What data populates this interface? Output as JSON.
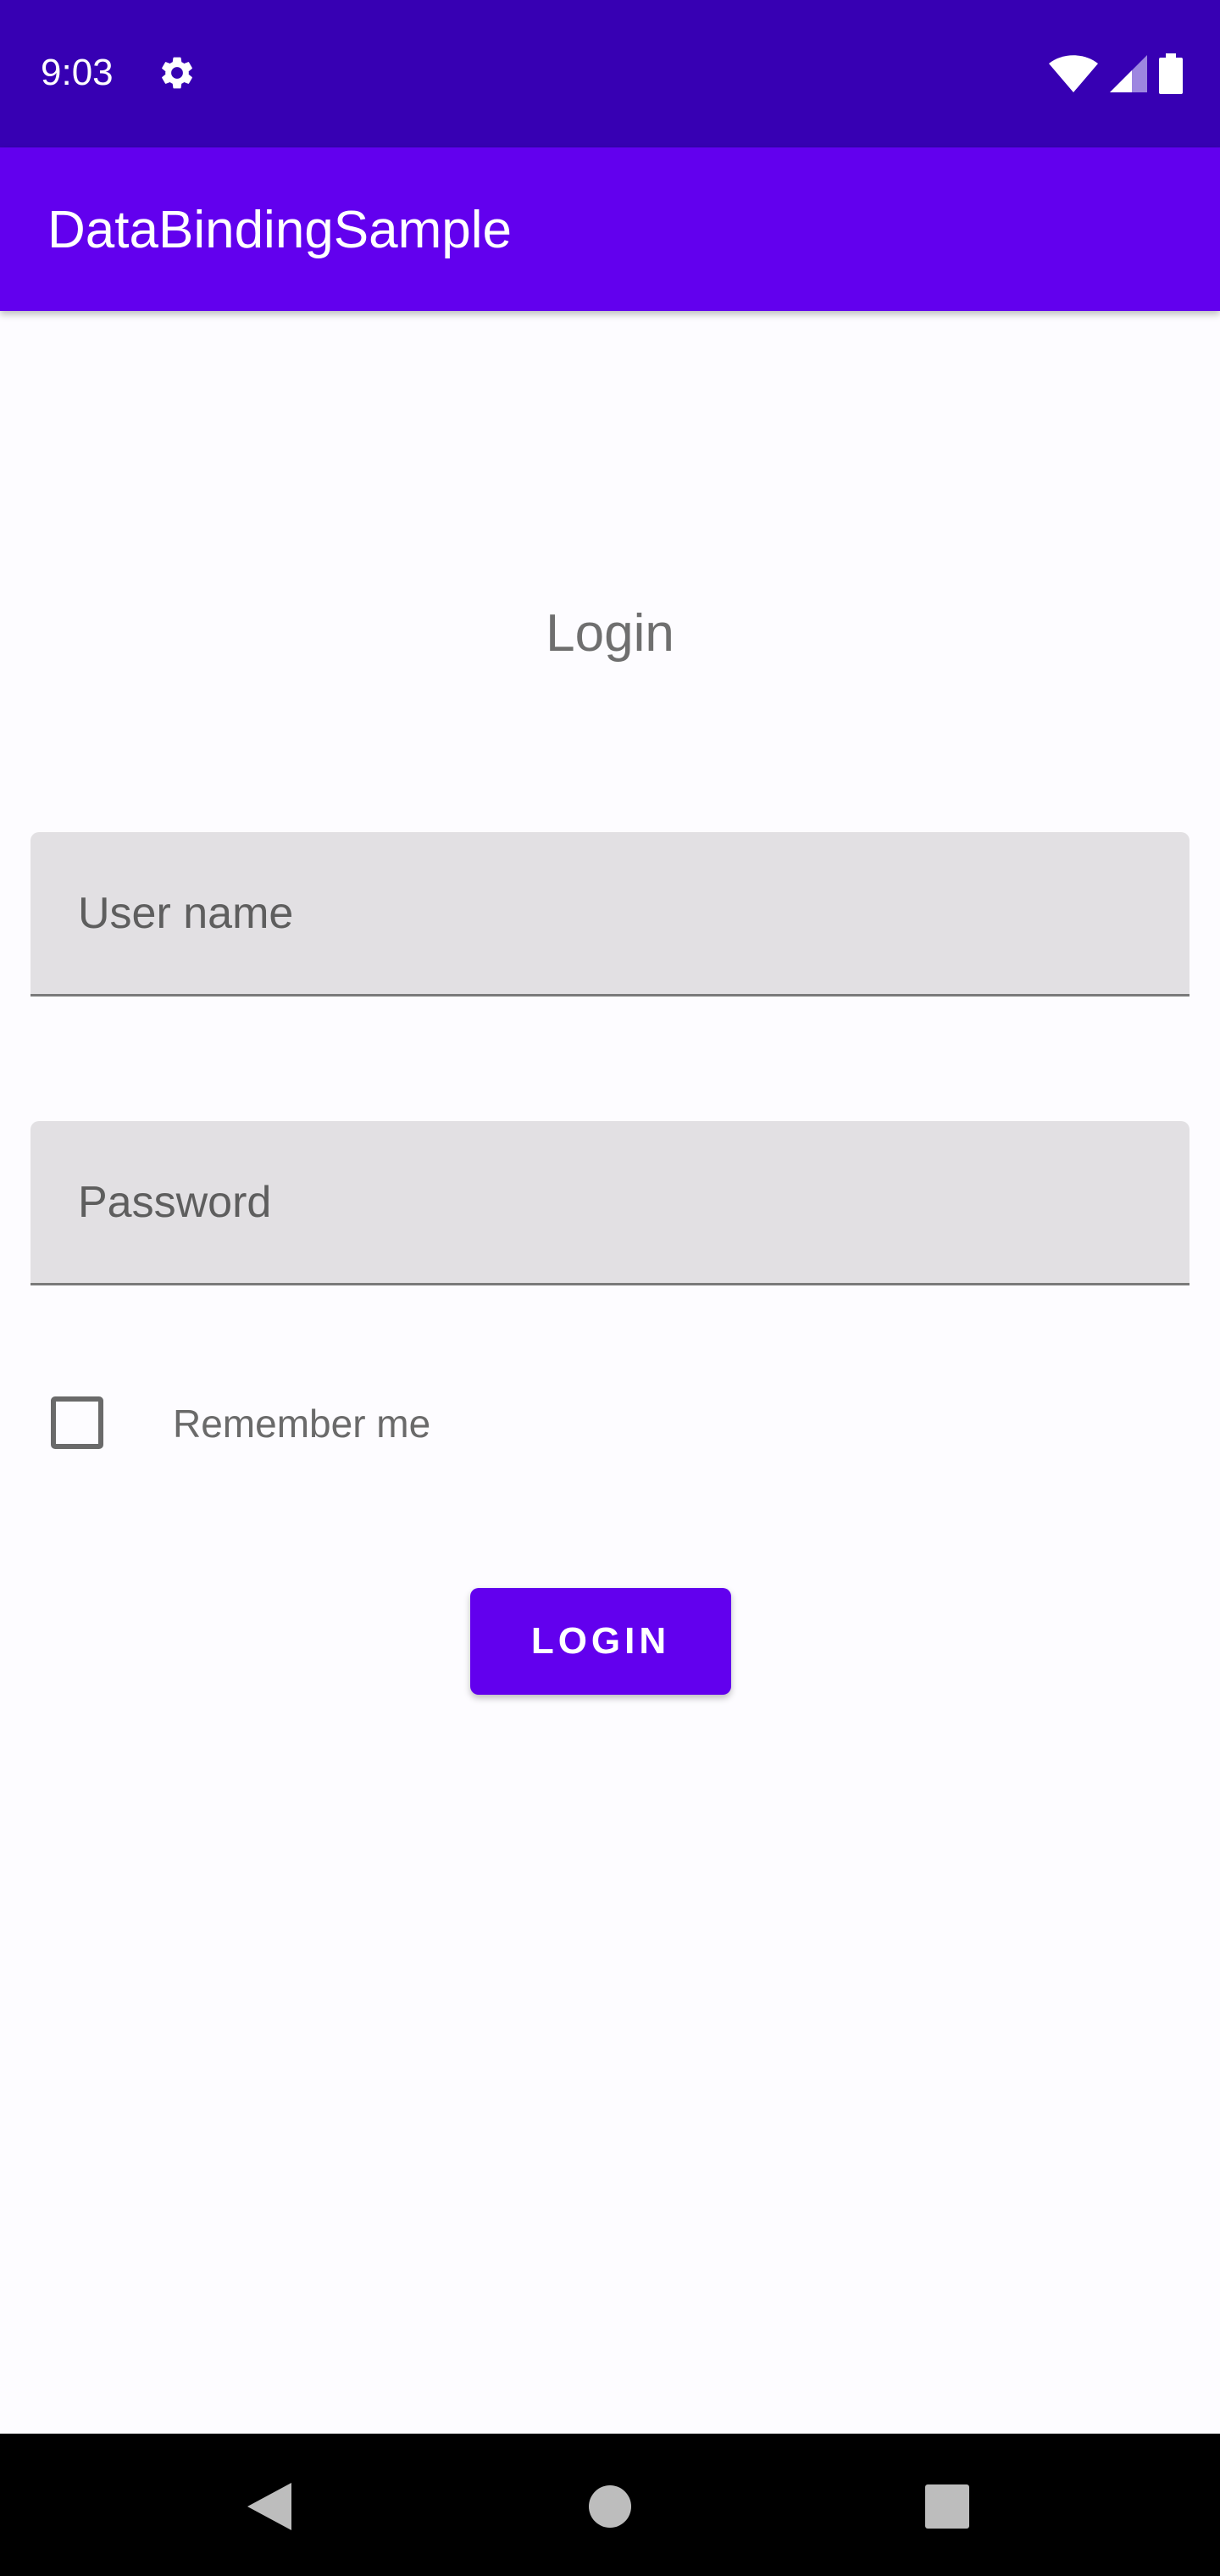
{
  "status_bar": {
    "time": "9:03",
    "icons": [
      "settings-gear-icon",
      "wifi-icon",
      "cellular-signal-icon",
      "battery-icon"
    ]
  },
  "app_bar": {
    "title": "DataBindingSample"
  },
  "login_form": {
    "title": "Login",
    "username_placeholder": "User name",
    "username_value": "",
    "password_placeholder": "Password",
    "password_value": "",
    "remember_me_label": "Remember me",
    "remember_me_checked": false,
    "login_button_label": "LOGIN"
  },
  "nav_bar": {
    "icons": [
      "back-icon",
      "home-icon",
      "recents-icon"
    ]
  },
  "colors": {
    "status_bar": "#3700B3",
    "primary": "#6200EE",
    "field_background": "#E2E0E3",
    "background": "#FDFCFF"
  }
}
